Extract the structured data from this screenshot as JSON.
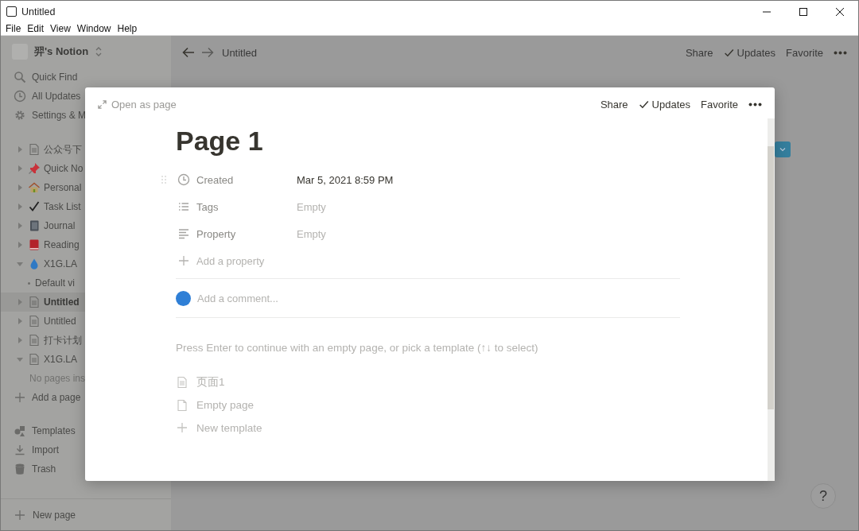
{
  "window": {
    "title": "Untitled",
    "menu": [
      "File",
      "Edit",
      "View",
      "Window",
      "Help"
    ]
  },
  "sidebar": {
    "workspace": "羿's Notion",
    "nav": [
      {
        "kind": "search",
        "label": "Quick Find"
      },
      {
        "kind": "clock",
        "label": "All Updates"
      },
      {
        "kind": "gear",
        "label": "Settings & M"
      }
    ],
    "pages": [
      {
        "title": "公众号下",
        "kind": "doc",
        "expanded": false,
        "selected": false
      },
      {
        "title": "Quick No",
        "kind": "pin",
        "expanded": false,
        "selected": false
      },
      {
        "title": "Personal",
        "kind": "house",
        "expanded": false,
        "selected": false
      },
      {
        "title": "Task List",
        "kind": "check",
        "expanded": false,
        "selected": false
      },
      {
        "title": "Journal",
        "kind": "notebook",
        "expanded": false,
        "selected": false
      },
      {
        "title": "Reading",
        "kind": "book",
        "expanded": false,
        "selected": false
      },
      {
        "title": "X1G.LA",
        "kind": "drop",
        "expanded": true,
        "selected": false,
        "children": [
          {
            "title": "Default vi",
            "kind": "view",
            "selected": false
          }
        ]
      },
      {
        "title": "Untitled",
        "kind": "doc",
        "expanded": false,
        "selected": true
      },
      {
        "title": "Untitled",
        "kind": "doc",
        "expanded": false,
        "selected": false
      },
      {
        "title": "打卡计划",
        "kind": "doc",
        "expanded": false,
        "selected": false
      },
      {
        "title": "X1G.LA",
        "kind": "doc",
        "expanded": true,
        "selected": false,
        "empty_note": "No pages ins"
      }
    ],
    "add_page": "Add a page",
    "tools": [
      {
        "kind": "templates",
        "label": "Templates"
      },
      {
        "kind": "import",
        "label": "Import"
      },
      {
        "kind": "trash",
        "label": "Trash"
      }
    ],
    "new_page": "New page"
  },
  "topbar": {
    "breadcrumb": "Untitled",
    "actions": [
      "Share",
      "Updates",
      "Favorite"
    ]
  },
  "modal": {
    "open_as_page": "Open as page",
    "actions": [
      "Share",
      "Updates",
      "Favorite"
    ],
    "title": "Page 1",
    "properties": [
      {
        "kind": "clock",
        "name": "Created",
        "value": "Mar 5, 2021 8:59 PM",
        "empty": false
      },
      {
        "kind": "list",
        "name": "Tags",
        "value": "Empty",
        "empty": true
      },
      {
        "kind": "text",
        "name": "Property",
        "value": "Empty",
        "empty": true
      }
    ],
    "add_property": "Add a property",
    "comment_placeholder": "Add a comment...",
    "hint": "Press Enter to continue with an empty page, or pick a template (↑↓ to select)",
    "templates": [
      {
        "kind": "doc",
        "label": "页面1"
      },
      {
        "kind": "blank",
        "label": "Empty page"
      },
      {
        "kind": "plus",
        "label": "New template"
      }
    ]
  },
  "help": "?"
}
